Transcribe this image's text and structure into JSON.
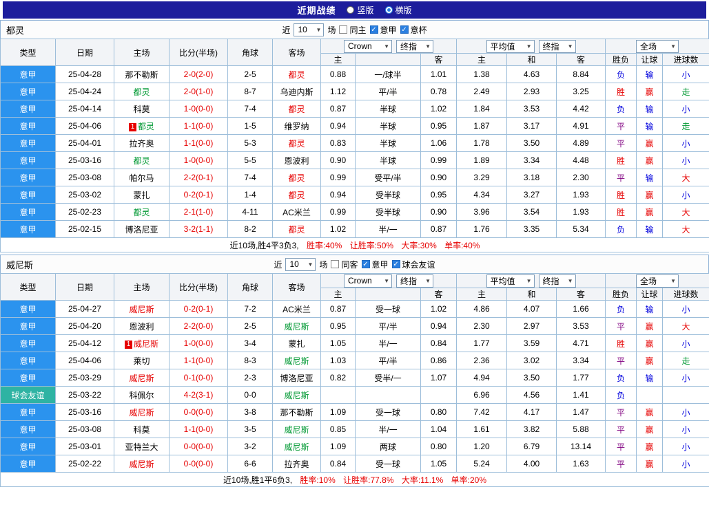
{
  "page": {
    "title": "近期战绩",
    "layout_options": [
      {
        "label": "竖版",
        "selected": false
      },
      {
        "label": "横版",
        "selected": true
      }
    ]
  },
  "palette": {
    "topbar_navy": "#1d1d9c",
    "grid_border": "#9dbeda",
    "league_serie_a_bg": "#2b93ee",
    "league_friendly_bg": "#2eb3a3",
    "score_red": "#e60000",
    "result_win_red": "#e60000",
    "result_lose_blue": "#0000dd",
    "result_draw_purple": "#800080",
    "result_push_green": "#009933",
    "focus_team_red": "#e60000",
    "focus_team_green": "#009933"
  },
  "header_labels": {
    "cols": [
      "类型",
      "日期",
      "主场",
      "比分(半场)",
      "角球",
      "客场"
    ],
    "sub": [
      "主",
      "",
      "客",
      "主",
      "和",
      "客",
      "胜负",
      "让球",
      "进球数"
    ]
  },
  "tables": [
    {
      "team": "都灵",
      "near_label": "近",
      "count": "10",
      "games_label": "场",
      "filters": [
        {
          "label": "同主",
          "checked": false
        },
        {
          "label": "意甲",
          "checked": true
        },
        {
          "label": "意杯",
          "checked": true
        }
      ],
      "selects": {
        "bookmaker": "Crown",
        "book_time": "终指",
        "average": "平均值",
        "avg_time": "终指",
        "scope": "全场"
      },
      "rows": [
        {
          "league": "意甲",
          "league_color": "#2b93ee",
          "date": "25-04-28",
          "home": "那不勒斯",
          "home_color": "#000000",
          "home_badge": "",
          "score": "2-0(2-0)",
          "corners": "2-5",
          "away": "都灵",
          "away_color": "#e60000",
          "away_badge": "",
          "crown": [
            "0.88",
            "一/球半",
            "1.01"
          ],
          "avg": [
            "1.38",
            "4.63",
            "8.84"
          ],
          "results": [
            [
              "负",
              "#0000dd"
            ],
            [
              "输",
              "#0000dd"
            ],
            [
              "小",
              "#0000dd"
            ]
          ]
        },
        {
          "league": "意甲",
          "league_color": "#2b93ee",
          "date": "25-04-24",
          "home": "都灵",
          "home_color": "#009933",
          "home_badge": "",
          "score": "2-0(1-0)",
          "corners": "8-7",
          "away": "乌迪内斯",
          "away_color": "#000000",
          "away_badge": "",
          "crown": [
            "1.12",
            "平/半",
            "0.78"
          ],
          "avg": [
            "2.49",
            "2.93",
            "3.25"
          ],
          "results": [
            [
              "胜",
              "#e60000"
            ],
            [
              "赢",
              "#e60000"
            ],
            [
              "走",
              "#009933"
            ]
          ]
        },
        {
          "league": "意甲",
          "league_color": "#2b93ee",
          "date": "25-04-14",
          "home": "科莫",
          "home_color": "#000000",
          "home_badge": "",
          "score": "1-0(0-0)",
          "corners": "7-4",
          "away": "都灵",
          "away_color": "#e60000",
          "away_badge": "",
          "crown": [
            "0.87",
            "半球",
            "1.02"
          ],
          "avg": [
            "1.84",
            "3.53",
            "4.42"
          ],
          "results": [
            [
              "负",
              "#0000dd"
            ],
            [
              "输",
              "#0000dd"
            ],
            [
              "小",
              "#0000dd"
            ]
          ]
        },
        {
          "league": "意甲",
          "league_color": "#2b93ee",
          "date": "25-04-06",
          "home": "都灵",
          "home_color": "#009933",
          "home_badge": "1",
          "score": "1-1(0-0)",
          "corners": "1-5",
          "away": "维罗纳",
          "away_color": "#000000",
          "away_badge": "",
          "crown": [
            "0.94",
            "半球",
            "0.95"
          ],
          "avg": [
            "1.87",
            "3.17",
            "4.91"
          ],
          "results": [
            [
              "平",
              "#800080"
            ],
            [
              "输",
              "#0000dd"
            ],
            [
              "走",
              "#009933"
            ]
          ]
        },
        {
          "league": "意甲",
          "league_color": "#2b93ee",
          "date": "25-04-01",
          "home": "拉齐奥",
          "home_color": "#000000",
          "home_badge": "",
          "score": "1-1(0-0)",
          "corners": "5-3",
          "away": "都灵",
          "away_color": "#e60000",
          "away_badge": "",
          "crown": [
            "0.83",
            "半球",
            "1.06"
          ],
          "avg": [
            "1.78",
            "3.50",
            "4.89"
          ],
          "results": [
            [
              "平",
              "#800080"
            ],
            [
              "赢",
              "#e60000"
            ],
            [
              "小",
              "#0000dd"
            ]
          ]
        },
        {
          "league": "意甲",
          "league_color": "#2b93ee",
          "date": "25-03-16",
          "home": "都灵",
          "home_color": "#009933",
          "home_badge": "",
          "score": "1-0(0-0)",
          "corners": "5-5",
          "away": "恩波利",
          "away_color": "#000000",
          "away_badge": "",
          "crown": [
            "0.90",
            "半球",
            "0.99"
          ],
          "avg": [
            "1.89",
            "3.34",
            "4.48"
          ],
          "results": [
            [
              "胜",
              "#e60000"
            ],
            [
              "赢",
              "#e60000"
            ],
            [
              "小",
              "#0000dd"
            ]
          ]
        },
        {
          "league": "意甲",
          "league_color": "#2b93ee",
          "date": "25-03-08",
          "home": "帕尔马",
          "home_color": "#000000",
          "home_badge": "",
          "score": "2-2(0-1)",
          "corners": "7-4",
          "away": "都灵",
          "away_color": "#e60000",
          "away_badge": "",
          "crown": [
            "0.99",
            "受平/半",
            "0.90"
          ],
          "avg": [
            "3.29",
            "3.18",
            "2.30"
          ],
          "results": [
            [
              "平",
              "#800080"
            ],
            [
              "输",
              "#0000dd"
            ],
            [
              "大",
              "#e60000"
            ]
          ]
        },
        {
          "league": "意甲",
          "league_color": "#2b93ee",
          "date": "25-03-02",
          "home": "蒙扎",
          "home_color": "#000000",
          "home_badge": "",
          "score": "0-2(0-1)",
          "corners": "1-4",
          "away": "都灵",
          "away_color": "#e60000",
          "away_badge": "",
          "crown": [
            "0.94",
            "受半球",
            "0.95"
          ],
          "avg": [
            "4.34",
            "3.27",
            "1.93"
          ],
          "results": [
            [
              "胜",
              "#e60000"
            ],
            [
              "赢",
              "#e60000"
            ],
            [
              "小",
              "#0000dd"
            ]
          ]
        },
        {
          "league": "意甲",
          "league_color": "#2b93ee",
          "date": "25-02-23",
          "home": "都灵",
          "home_color": "#009933",
          "home_badge": "",
          "score": "2-1(1-0)",
          "corners": "4-11",
          "away": "AC米兰",
          "away_color": "#000000",
          "away_badge": "",
          "crown": [
            "0.99",
            "受半球",
            "0.90"
          ],
          "avg": [
            "3.96",
            "3.54",
            "1.93"
          ],
          "results": [
            [
              "胜",
              "#e60000"
            ],
            [
              "赢",
              "#e60000"
            ],
            [
              "大",
              "#e60000"
            ]
          ]
        },
        {
          "league": "意甲",
          "league_color": "#2b93ee",
          "date": "25-02-15",
          "home": "博洛尼亚",
          "home_color": "#000000",
          "home_badge": "",
          "score": "3-2(1-1)",
          "corners": "8-2",
          "away": "都灵",
          "away_color": "#e60000",
          "away_badge": "",
          "crown": [
            "1.02",
            "半/一",
            "0.87"
          ],
          "avg": [
            "1.76",
            "3.35",
            "5.34"
          ],
          "results": [
            [
              "负",
              "#0000dd"
            ],
            [
              "输",
              "#0000dd"
            ],
            [
              "大",
              "#e60000"
            ]
          ]
        }
      ],
      "summary": {
        "prefix": "近10场,胜4平3负3,",
        "stats": [
          "胜率:40%",
          "让胜率:50%",
          "大率:30%",
          "单率:40%"
        ]
      }
    },
    {
      "team": "威尼斯",
      "near_label": "近",
      "count": "10",
      "games_label": "场",
      "filters": [
        {
          "label": "同客",
          "checked": false
        },
        {
          "label": "意甲",
          "checked": true
        },
        {
          "label": "球会友谊",
          "checked": true
        }
      ],
      "selects": {
        "bookmaker": "Crown",
        "book_time": "终指",
        "average": "平均值",
        "avg_time": "终指",
        "scope": "全场"
      },
      "rows": [
        {
          "league": "意甲",
          "league_color": "#2b93ee",
          "date": "25-04-27",
          "home": "威尼斯",
          "home_color": "#e60000",
          "home_badge": "",
          "score": "0-2(0-1)",
          "corners": "7-2",
          "away": "AC米兰",
          "away_color": "#000000",
          "away_badge": "",
          "crown": [
            "0.87",
            "受一球",
            "1.02"
          ],
          "avg": [
            "4.86",
            "4.07",
            "1.66"
          ],
          "results": [
            [
              "负",
              "#0000dd"
            ],
            [
              "输",
              "#0000dd"
            ],
            [
              "小",
              "#0000dd"
            ]
          ]
        },
        {
          "league": "意甲",
          "league_color": "#2b93ee",
          "date": "25-04-20",
          "home": "恩波利",
          "home_color": "#000000",
          "home_badge": "",
          "score": "2-2(0-0)",
          "corners": "2-5",
          "away": "威尼斯",
          "away_color": "#009933",
          "away_badge": "",
          "crown": [
            "0.95",
            "平/半",
            "0.94"
          ],
          "avg": [
            "2.30",
            "2.97",
            "3.53"
          ],
          "results": [
            [
              "平",
              "#800080"
            ],
            [
              "赢",
              "#e60000"
            ],
            [
              "大",
              "#e60000"
            ]
          ]
        },
        {
          "league": "意甲",
          "league_color": "#2b93ee",
          "date": "25-04-12",
          "home": "威尼斯",
          "home_color": "#e60000",
          "home_badge": "1",
          "score": "1-0(0-0)",
          "corners": "3-4",
          "away": "蒙扎",
          "away_color": "#000000",
          "away_badge": "",
          "crown": [
            "1.05",
            "半/一",
            "0.84"
          ],
          "avg": [
            "1.77",
            "3.59",
            "4.71"
          ],
          "results": [
            [
              "胜",
              "#e60000"
            ],
            [
              "赢",
              "#e60000"
            ],
            [
              "小",
              "#0000dd"
            ]
          ]
        },
        {
          "league": "意甲",
          "league_color": "#2b93ee",
          "date": "25-04-06",
          "home": "莱切",
          "home_color": "#000000",
          "home_badge": "",
          "score": "1-1(0-0)",
          "corners": "8-3",
          "away": "威尼斯",
          "away_color": "#009933",
          "away_badge": "",
          "crown": [
            "1.03",
            "平/半",
            "0.86"
          ],
          "avg": [
            "2.36",
            "3.02",
            "3.34"
          ],
          "results": [
            [
              "平",
              "#800080"
            ],
            [
              "赢",
              "#e60000"
            ],
            [
              "走",
              "#009933"
            ]
          ]
        },
        {
          "league": "意甲",
          "league_color": "#2b93ee",
          "date": "25-03-29",
          "home": "威尼斯",
          "home_color": "#e60000",
          "home_badge": "",
          "score": "0-1(0-0)",
          "corners": "2-3",
          "away": "博洛尼亚",
          "away_color": "#000000",
          "away_badge": "",
          "crown": [
            "0.82",
            "受半/一",
            "1.07"
          ],
          "avg": [
            "4.94",
            "3.50",
            "1.77"
          ],
          "results": [
            [
              "负",
              "#0000dd"
            ],
            [
              "输",
              "#0000dd"
            ],
            [
              "小",
              "#0000dd"
            ]
          ]
        },
        {
          "league": "球会友谊",
          "league_color": "#2eb3a3",
          "date": "25-03-22",
          "home": "科佩尔",
          "home_color": "#000000",
          "home_badge": "",
          "score": "4-2(3-1)",
          "corners": "0-0",
          "away": "威尼斯",
          "away_color": "#009933",
          "away_badge": "",
          "crown": [
            "",
            "",
            ""
          ],
          "avg": [
            "6.96",
            "4.56",
            "1.41"
          ],
          "results": [
            [
              "负",
              "#0000dd"
            ],
            [
              "",
              ""
            ],
            [
              "",
              ""
            ]
          ]
        },
        {
          "league": "意甲",
          "league_color": "#2b93ee",
          "date": "25-03-16",
          "home": "威尼斯",
          "home_color": "#e60000",
          "home_badge": "",
          "score": "0-0(0-0)",
          "corners": "3-8",
          "away": "那不勒斯",
          "away_color": "#000000",
          "away_badge": "",
          "crown": [
            "1.09",
            "受一球",
            "0.80"
          ],
          "avg": [
            "7.42",
            "4.17",
            "1.47"
          ],
          "results": [
            [
              "平",
              "#800080"
            ],
            [
              "赢",
              "#e60000"
            ],
            [
              "小",
              "#0000dd"
            ]
          ]
        },
        {
          "league": "意甲",
          "league_color": "#2b93ee",
          "date": "25-03-08",
          "home": "科莫",
          "home_color": "#000000",
          "home_badge": "",
          "score": "1-1(0-0)",
          "corners": "3-5",
          "away": "威尼斯",
          "away_color": "#009933",
          "away_badge": "",
          "crown": [
            "0.85",
            "半/一",
            "1.04"
          ],
          "avg": [
            "1.61",
            "3.82",
            "5.88"
          ],
          "results": [
            [
              "平",
              "#800080"
            ],
            [
              "赢",
              "#e60000"
            ],
            [
              "小",
              "#0000dd"
            ]
          ]
        },
        {
          "league": "意甲",
          "league_color": "#2b93ee",
          "date": "25-03-01",
          "home": "亚特兰大",
          "home_color": "#000000",
          "home_badge": "",
          "score": "0-0(0-0)",
          "corners": "3-2",
          "away": "威尼斯",
          "away_color": "#009933",
          "away_badge": "",
          "crown": [
            "1.09",
            "两球",
            "0.80"
          ],
          "avg": [
            "1.20",
            "6.79",
            "13.14"
          ],
          "results": [
            [
              "平",
              "#800080"
            ],
            [
              "赢",
              "#e60000"
            ],
            [
              "小",
              "#0000dd"
            ]
          ]
        },
        {
          "league": "意甲",
          "league_color": "#2b93ee",
          "date": "25-02-22",
          "home": "威尼斯",
          "home_color": "#e60000",
          "home_badge": "",
          "score": "0-0(0-0)",
          "corners": "6-6",
          "away": "拉齐奥",
          "away_color": "#000000",
          "away_badge": "",
          "crown": [
            "0.84",
            "受一球",
            "1.05"
          ],
          "avg": [
            "5.24",
            "4.00",
            "1.63"
          ],
          "results": [
            [
              "平",
              "#800080"
            ],
            [
              "赢",
              "#e60000"
            ],
            [
              "小",
              "#0000dd"
            ]
          ]
        }
      ],
      "summary": {
        "prefix": "近10场,胜1平6负3,",
        "stats": [
          "胜率:10%",
          "让胜率:77.8%",
          "大率:11.1%",
          "单率:20%"
        ]
      }
    }
  ]
}
